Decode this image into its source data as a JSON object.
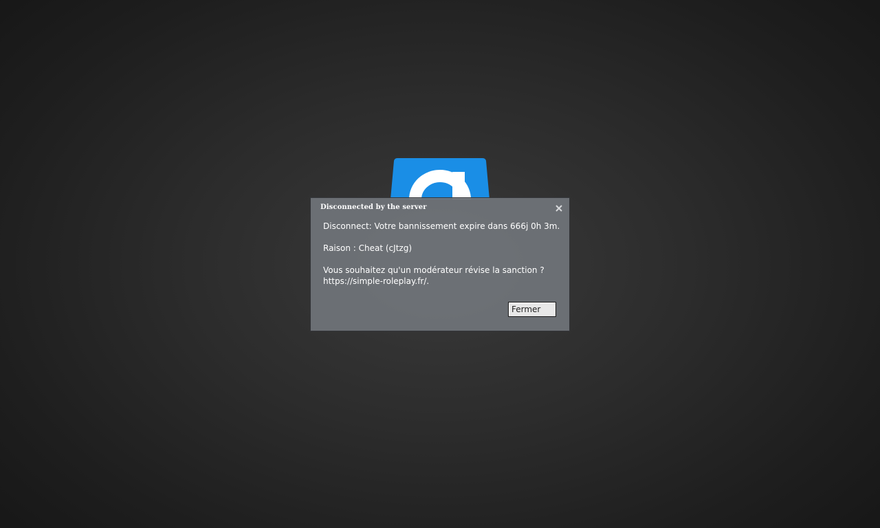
{
  "background": {
    "logo_icon": "garrysmod-g-logo-icon",
    "logo_color": "#1a8ee6"
  },
  "dialog": {
    "title": "Disconnected by the server",
    "close_icon": "close-icon",
    "message": {
      "line1": "Disconnect: Votre bannissement expire dans 666j 0h 3m.",
      "line2": "Raison : Cheat (cJtzg)",
      "line3": "Vous souhaitez qu'un modérateur révise la sanction ?",
      "line4": "https://simple-roleplay.fr/."
    },
    "button_label": "Fermer"
  }
}
